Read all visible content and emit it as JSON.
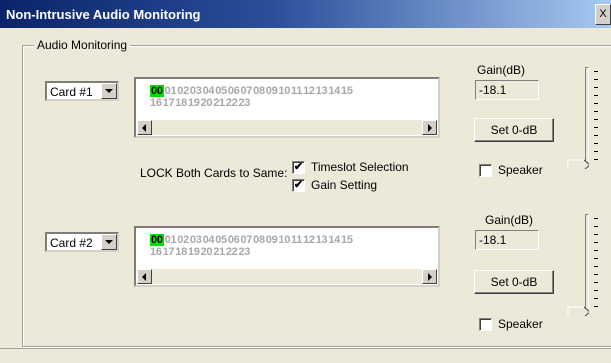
{
  "window": {
    "title": "Non-Intrusive Audio Monitoring",
    "close_glyph": "X"
  },
  "group_label": "Audio Monitoring",
  "lock": {
    "label": "LOCK Both Cards to Same:",
    "timeslot_label": "Timeslot Selection",
    "timeslot_checked": "✔",
    "gain_label": "Gain Setting",
    "gain_checked": "✔"
  },
  "card1": {
    "selected_card": "Card #1",
    "timeslots_row1": [
      "00",
      "01",
      "02",
      "03",
      "04",
      "05",
      "06",
      "07",
      "08",
      "09",
      "10",
      "11",
      "12",
      "13",
      "14",
      "15"
    ],
    "timeslots_row2": [
      "16",
      "17",
      "18",
      "19",
      "20",
      "21",
      "22",
      "23"
    ],
    "selected_slot": "00",
    "gain_label": "Gain(dB)",
    "gain_value": "-18.1",
    "set0_label": "Set 0-dB",
    "speaker_label": "Speaker",
    "slider_level": 0.0
  },
  "card2": {
    "selected_card": "Card #2",
    "timeslots_row1": [
      "00",
      "01",
      "02",
      "03",
      "04",
      "05",
      "06",
      "07",
      "08",
      "09",
      "10",
      "11",
      "12",
      "13",
      "14",
      "15"
    ],
    "timeslots_row2": [
      "16",
      "17",
      "18",
      "19",
      "20",
      "21",
      "22",
      "23"
    ],
    "selected_slot": "00",
    "gain_label": "Gain(dB)",
    "gain_value": "-18.1",
    "set0_label": "Set 0-dB",
    "speaker_label": "Speaker",
    "slider_level": 0.0
  },
  "colors": {
    "selected_slot": "#00e000",
    "unselected_slot": "#a8a8a8",
    "titlebar": "#0a246a"
  }
}
